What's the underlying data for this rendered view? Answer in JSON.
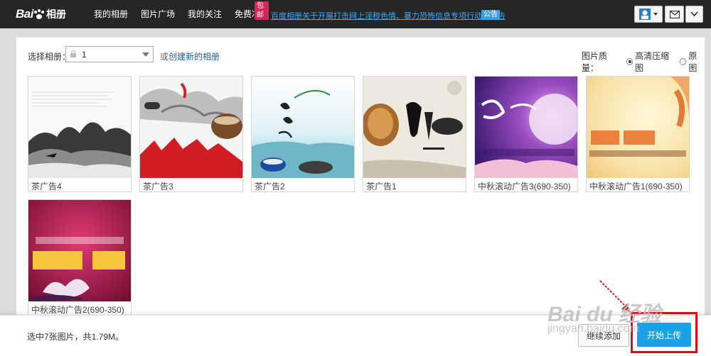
{
  "header": {
    "logo_text": "Bai",
    "logo_text2": "相册",
    "nav": [
      "我的相册",
      "图片广场",
      "我的关注",
      "免费冲印"
    ],
    "badge": "包邮",
    "notice": "百度相册关于开展打击网上淫秽色情、暴力恐怖信息专项行动的公告",
    "notice_tag": "公告"
  },
  "panel": {
    "select_label": "选择相册：",
    "album_value": "1",
    "create_prefix": "或",
    "create_link": "创建新的相册",
    "quality_label": "图片质量：",
    "quality_high": "高清压缩图",
    "quality_orig": "原图"
  },
  "thumbnails": [
    {
      "caption": "茶广告4"
    },
    {
      "caption": "茶广告3"
    },
    {
      "caption": "茶广告2"
    },
    {
      "caption": "茶广告1"
    },
    {
      "caption": "中秋滚动广告3(690-350)"
    },
    {
      "caption": "中秋滚动广告1(690-350)"
    },
    {
      "caption": "中秋滚动广告2(690-350)"
    }
  ],
  "footer": {
    "summary": "选中7张图片，共1.79M。",
    "continue_label": "继续添加",
    "upload_label": "开始上传"
  },
  "watermark": {
    "line1": "Bai du 经验",
    "line2": "jingyan.baidu.com"
  },
  "colors": {
    "topbar": "#262626",
    "accent": "#1aa1e6",
    "highlight": "#c8161d"
  }
}
